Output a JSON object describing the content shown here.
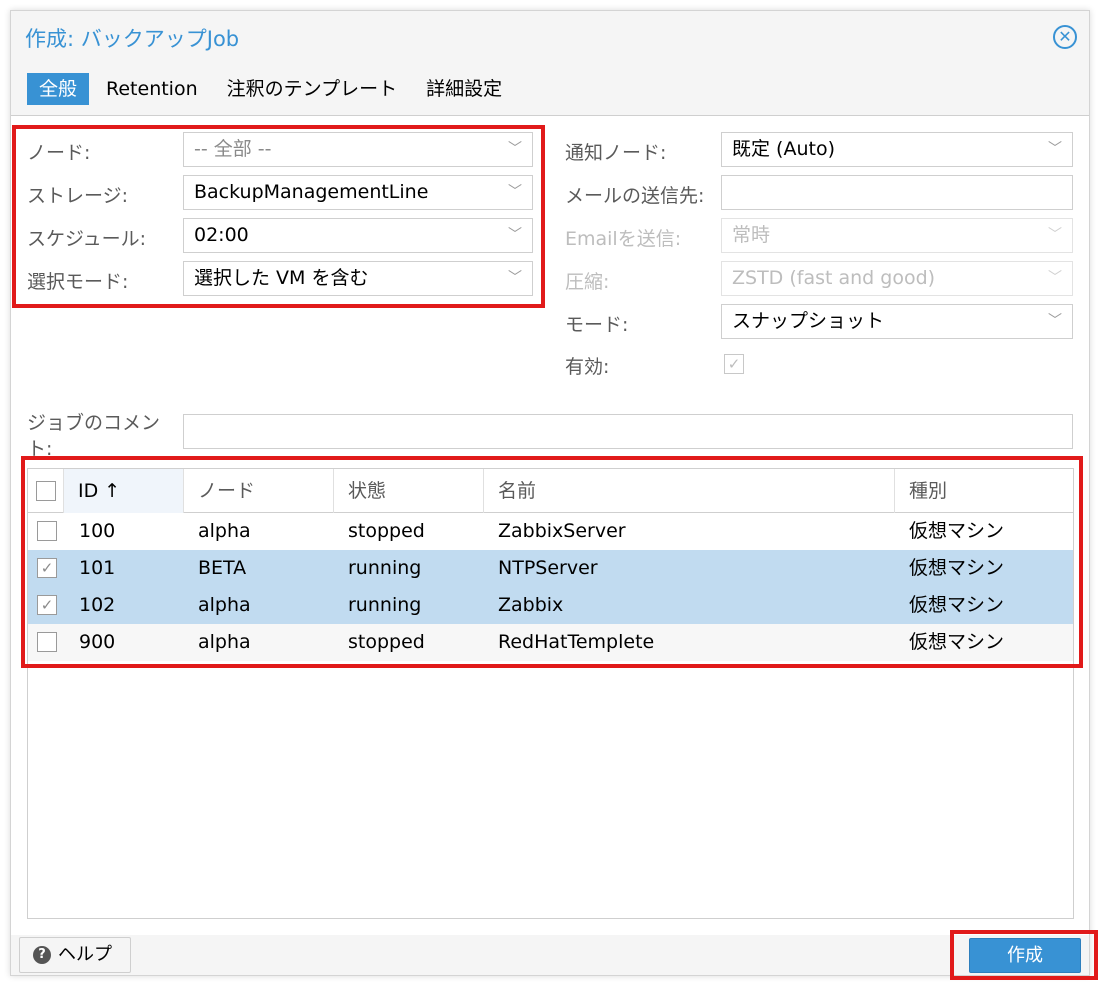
{
  "window": {
    "title": "作成: バックアップJob"
  },
  "tabs": [
    {
      "label": "全般",
      "active": true
    },
    {
      "label": "Retention",
      "active": false
    },
    {
      "label": "注釈のテンプレート",
      "active": false
    },
    {
      "label": "詳細設定",
      "active": false
    }
  ],
  "left_form": {
    "node_label": "ノード:",
    "node_value": "-- 全部 --",
    "storage_label": "ストレージ:",
    "storage_value": "BackupManagementLine",
    "schedule_label": "スケジュール:",
    "schedule_value": "02:00",
    "selection_label": "選択モード:",
    "selection_value": "選択した VM を含む"
  },
  "right_form": {
    "notify_node_label": "通知ノード:",
    "notify_node_value": "既定 (Auto)",
    "mail_label": "メールの送信先:",
    "mail_value": "",
    "email_send_label": "Emailを送信:",
    "email_send_value": "常時",
    "compress_label": "圧縮:",
    "compress_value": "ZSTD (fast and good)",
    "mode_label": "モード:",
    "mode_value": "スナップショット",
    "enabled_label": "有効:",
    "enabled_checked": true
  },
  "comment": {
    "label": "ジョブのコメント:",
    "value": ""
  },
  "grid": {
    "columns": [
      "ID ↑",
      "ノード",
      "状態",
      "名前",
      "種別"
    ],
    "rows": [
      {
        "checked": false,
        "id": "100",
        "node": "alpha",
        "status": "stopped",
        "name": "ZabbixServer",
        "type": "仮想マシン"
      },
      {
        "checked": true,
        "id": "101",
        "node": "BETA",
        "status": "running",
        "name": "NTPServer",
        "type": "仮想マシン"
      },
      {
        "checked": true,
        "id": "102",
        "node": "alpha",
        "status": "running",
        "name": "Zabbix",
        "type": "仮想マシン"
      },
      {
        "checked": false,
        "id": "900",
        "node": "alpha",
        "status": "stopped",
        "name": "RedHatTemplete",
        "type": "仮想マシン"
      }
    ]
  },
  "footer": {
    "help_label": "ヘルプ",
    "create_label": "作成"
  },
  "icons": {
    "close": "close-icon",
    "help": "help-icon",
    "chevron": "chevron-down-icon",
    "check": "check-icon"
  },
  "colors": {
    "accent": "#3892d4",
    "selection": "#c1dbf0",
    "highlight": "#e11a1a"
  }
}
